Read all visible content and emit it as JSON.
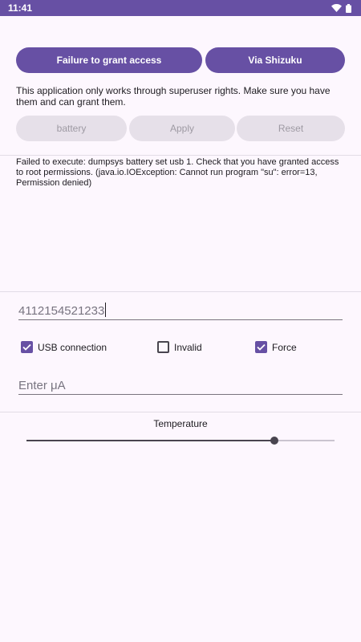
{
  "status_bar": {
    "time": "11:41",
    "icons": [
      "wifi-icon",
      "battery-icon"
    ]
  },
  "actions": {
    "grant_label": "Failure to grant access",
    "shizuku_label": "Via Shizuku"
  },
  "info_text": "This application only works through superuser rights. Make sure you have them and can grant them.",
  "controls": {
    "battery_label": "battery",
    "apply_label": "Apply",
    "reset_label": "Reset"
  },
  "error_text": "Failed to execute: dumpsys battery set usb 1. Check that you have granted access to root permissions. (java.io.IOException: Cannot run program \"su\": error=13, Permission denied)",
  "serial_field": {
    "value": "4112154521233"
  },
  "checkboxes": [
    {
      "label": "USB connection",
      "checked": true
    },
    {
      "label": "Invalid",
      "checked": false
    },
    {
      "label": "Force",
      "checked": true
    }
  ],
  "current_field": {
    "placeholder": "Enter μA"
  },
  "temperature": {
    "label": "Temperature",
    "level": 0.8
  },
  "colors": {
    "primary": "#6750a4",
    "background": "#fdf7fe",
    "disabled_bg": "#e6e0e9",
    "disabled_text": "#9e9aa3"
  }
}
